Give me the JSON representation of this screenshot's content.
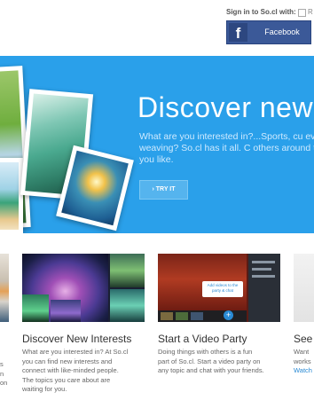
{
  "signin": {
    "label": "Sign in to So.cl with:",
    "remember_label": "R",
    "facebook_label": "Facebook",
    "facebook_color": "#3b5998"
  },
  "hero": {
    "title": "Discover new T",
    "description": "What are you interested in?...Sports, cu even basket weaving? So.cl has it all. C others around the topics you like.",
    "try_label": "› TRY IT",
    "background": "#2aa0ea"
  },
  "cards": [
    {
      "title": "Discover New Interests",
      "description_lines": [
        "What are you interested in? At So.cl",
        "you can find new interests and",
        "connect with like-minded people.",
        "The topics you care about are",
        "waiting for you."
      ]
    },
    {
      "title": "Start a Video Party",
      "video_caption": "Add videos to the party & chat",
      "description_lines": [
        "Doing things with others is a fun",
        "part of So.cl. Start a video party on",
        "any topic and chat with your friends."
      ]
    },
    {
      "title": "See",
      "description_lines": [
        "Want",
        "works"
      ],
      "watch_label": "Watch"
    }
  ],
  "left_fragment_lines": [
    "s",
    "n",
    "on"
  ]
}
